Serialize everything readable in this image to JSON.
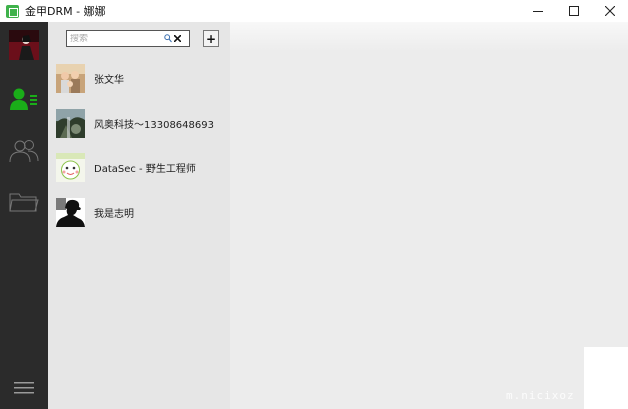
{
  "window": {
    "title": "金甲DRM - 娜娜",
    "controls": {
      "minimize": "—",
      "maximize": "☐",
      "close": "✕"
    }
  },
  "sidebar": {
    "avatar_icon": "user-avatar",
    "items": [
      {
        "name": "contacts",
        "icon": "contacts-icon",
        "active": true
      },
      {
        "name": "groups",
        "icon": "group-icon",
        "active": false
      },
      {
        "name": "files",
        "icon": "folder-icon",
        "active": false
      }
    ],
    "menu_icon": "hamburger-menu-icon",
    "accent": "#1aad19"
  },
  "search": {
    "placeholder": "搜索",
    "value": ""
  },
  "add_button": {
    "label": "+"
  },
  "contacts": [
    {
      "name": "张文华",
      "avatar": "photo-group-avatar"
    },
    {
      "name": "风奥科技～13308648693",
      "avatar": "landscape-avatar"
    },
    {
      "name": "DataSec - 野生工程师",
      "avatar": "cartoon-avatar"
    },
    {
      "name": "我是志明",
      "avatar": "silhouette-avatar"
    }
  ],
  "watermark": "m.nicixoz"
}
